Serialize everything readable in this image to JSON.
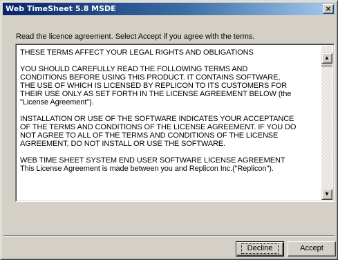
{
  "window": {
    "title": "Web TimeSheet 5.8 MSDE",
    "close_glyph": "×"
  },
  "instruction": "Read the licence agreement. Select Accept if you agree with the terms.",
  "license_text": "THESE TERMS AFFECT YOUR LEGAL RIGHTS AND OBLIGATIONS\n\nYOU SHOULD CAREFULLY READ THE FOLLOWING TERMS AND\nCONDITIONS BEFORE USING THIS PRODUCT. IT CONTAINS SOFTWARE,\nTHE USE OF WHICH IS LICENSED BY REPLICON TO ITS CUSTOMERS FOR\nTHEIR USE ONLY AS SET FORTH IN THE LICENSE AGREEMENT BELOW (the\n\"License Agreement\").\n\nINSTALLATION OR USE OF THE SOFTWARE INDICATES YOUR ACCEPTANCE\nOF THE TERMS AND CONDITIONS OF THE LICENSE AGREEMENT. IF YOU DO\nNOT AGREE TO ALL OF THE TERMS AND CONDITIONS OF THE LICENSE\nAGREEMENT, DO NOT INSTALL OR USE THE SOFTWARE.\n\nWEB TIME SHEET SYSTEM END USER SOFTWARE LICENSE AGREEMENT\nThis License Agreement is made between you and Replicon Inc.(\"Replicon\").",
  "scrollbar": {
    "up_glyph": "▲",
    "down_glyph": "▼"
  },
  "buttons": {
    "decline_label": "Decline",
    "accept_label": "Accept"
  }
}
